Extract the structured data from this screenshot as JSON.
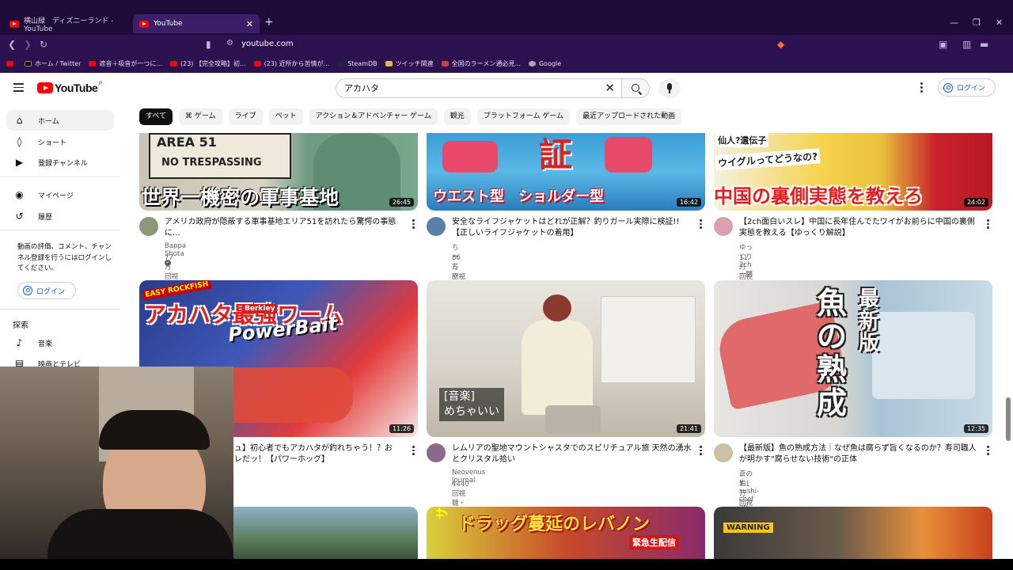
{
  "browser": {
    "tabs": [
      {
        "label": "横山緑　ディズニーランド - YouTube",
        "active": false
      },
      {
        "label": "YouTube",
        "active": true
      }
    ],
    "new_tab": "+",
    "url": "youtube.com",
    "bookmarks": [
      "ホーム / Twitter",
      "遮音＋吸音が一つに...",
      "(23) 【完全攻略】初...",
      "(23) 近所から苦情が...",
      "SteamDB",
      "ツイッチ関連",
      "全国のラーメン通必見...",
      "Google"
    ]
  },
  "masthead": {
    "logo_text": "YouTube",
    "logo_region": "JP",
    "search_value": "アカハタ",
    "signin_label": "ログイン"
  },
  "chips": [
    "すべて",
    "ゲーム",
    "ライブ",
    "ペット",
    "アクション＆アドベンチャー ゲーム",
    "観光",
    "プラットフォーム ゲーム",
    "最近アップロードされた動画"
  ],
  "sidebar": {
    "items": [
      {
        "label": "ホーム",
        "icon": "home-icon"
      },
      {
        "label": "ショート",
        "icon": "shorts-icon"
      },
      {
        "label": "登録チャンネル",
        "icon": "subscriptions-icon"
      },
      {
        "label": "マイページ",
        "icon": "you-icon"
      },
      {
        "label": "履歴",
        "icon": "history-icon"
      }
    ],
    "note": "動画の評価、コメント、チャンネル登録を行うにはログインしてください。",
    "signin_label": "ログイン",
    "explore_heading": "探索",
    "explore_items": [
      {
        "label": "音楽",
        "icon": "music-icon"
      },
      {
        "label": "映画とテレビ",
        "icon": "movie-icon"
      }
    ]
  },
  "videos": [
    {
      "title": "アメリカ政府が隠蔽する軍事基地エリア51を訪れたら驚愕の事態に...",
      "channel": "Bappa Shota",
      "verified": true,
      "meta": "77万 回視聴・1 年前",
      "duration": "26:45",
      "overlay": "世界一機密の軍事基地"
    },
    {
      "title": "安全なライフジャケットはどれが正解？釣りガール実際に検証!!【正しいライフジャケットの着用】",
      "channel": "ちーちゃんフィッシング倶楽部",
      "verified": false,
      "meta": "86万 回視聴・2 年前",
      "duration": "16:42",
      "overlay": "ウエスト型　ショルダー型"
    },
    {
      "title": "【2ch面白いスレ】中国に長年住んでたワイがお前らに中国の裏側実態を教える【ゆっくり解説】",
      "channel": "ゆっくり2ch一問一答【質問ある?系まとめ】",
      "verified": false,
      "meta": "11万 回視聴・1 か月前",
      "duration": "24:02",
      "overlay": "中国の裏側実態を教えろ"
    },
    {
      "title": "ュ】初心者でもアカハタが釣れちゃう！？お\nレだッ！【パワーホッグ】",
      "channel": "",
      "verified": false,
      "meta": "",
      "duration": "11:26",
      "overlay": "アカハタ最強ワーム"
    },
    {
      "title": "レムリアの聖地マウントシャスタでのスピリチュアル旅 天然の湧水とクリスタル拾い",
      "channel": "Neovenus Journal",
      "verified": false,
      "meta": "4440 回視聴・1 年前",
      "duration": "21:41",
      "overlay": "[音楽]\nめちゃいい"
    },
    {
      "title": "【最新版】魚の熟成方法｜なぜ魚は腐らず旨くなるのか？寿司職人が明かす\"腐らせない技術\"の正体",
      "channel": "蒼の鮨 sushi-chef ao",
      "verified": false,
      "meta": "7.1万 回視聴・4 週間前",
      "duration": "12:35",
      "overlay": "魚の熟成　最新版"
    },
    {
      "title": "",
      "channel": "",
      "verified": false,
      "meta": "",
      "duration": "",
      "overlay": ""
    },
    {
      "title": "",
      "channel": "",
      "verified": false,
      "meta": "",
      "duration": "",
      "overlay": "ドラッグ蔓延のレバノン"
    },
    {
      "title": "",
      "channel": "",
      "verified": false,
      "meta": "",
      "duration": "",
      "overlay": "WARNING"
    }
  ],
  "thumb_texts": {
    "area51": "AREA 51",
    "no_trespassing": "NO TRESPASSING",
    "shou": "証",
    "china_q1": "仙人?遺伝子",
    "china_q2": "ウイグルってどうなの?",
    "easy": "EASY ROCKFISH",
    "powerbait": "PowerBait",
    "berkley": "Berkley",
    "fish_char1": "魚",
    "fish_char2": "の",
    "fish_char3": "熟",
    "fish_char4": "成",
    "fish_new": "最新版",
    "urgent": "緊急生配信",
    "sanji": "サンジ"
  }
}
